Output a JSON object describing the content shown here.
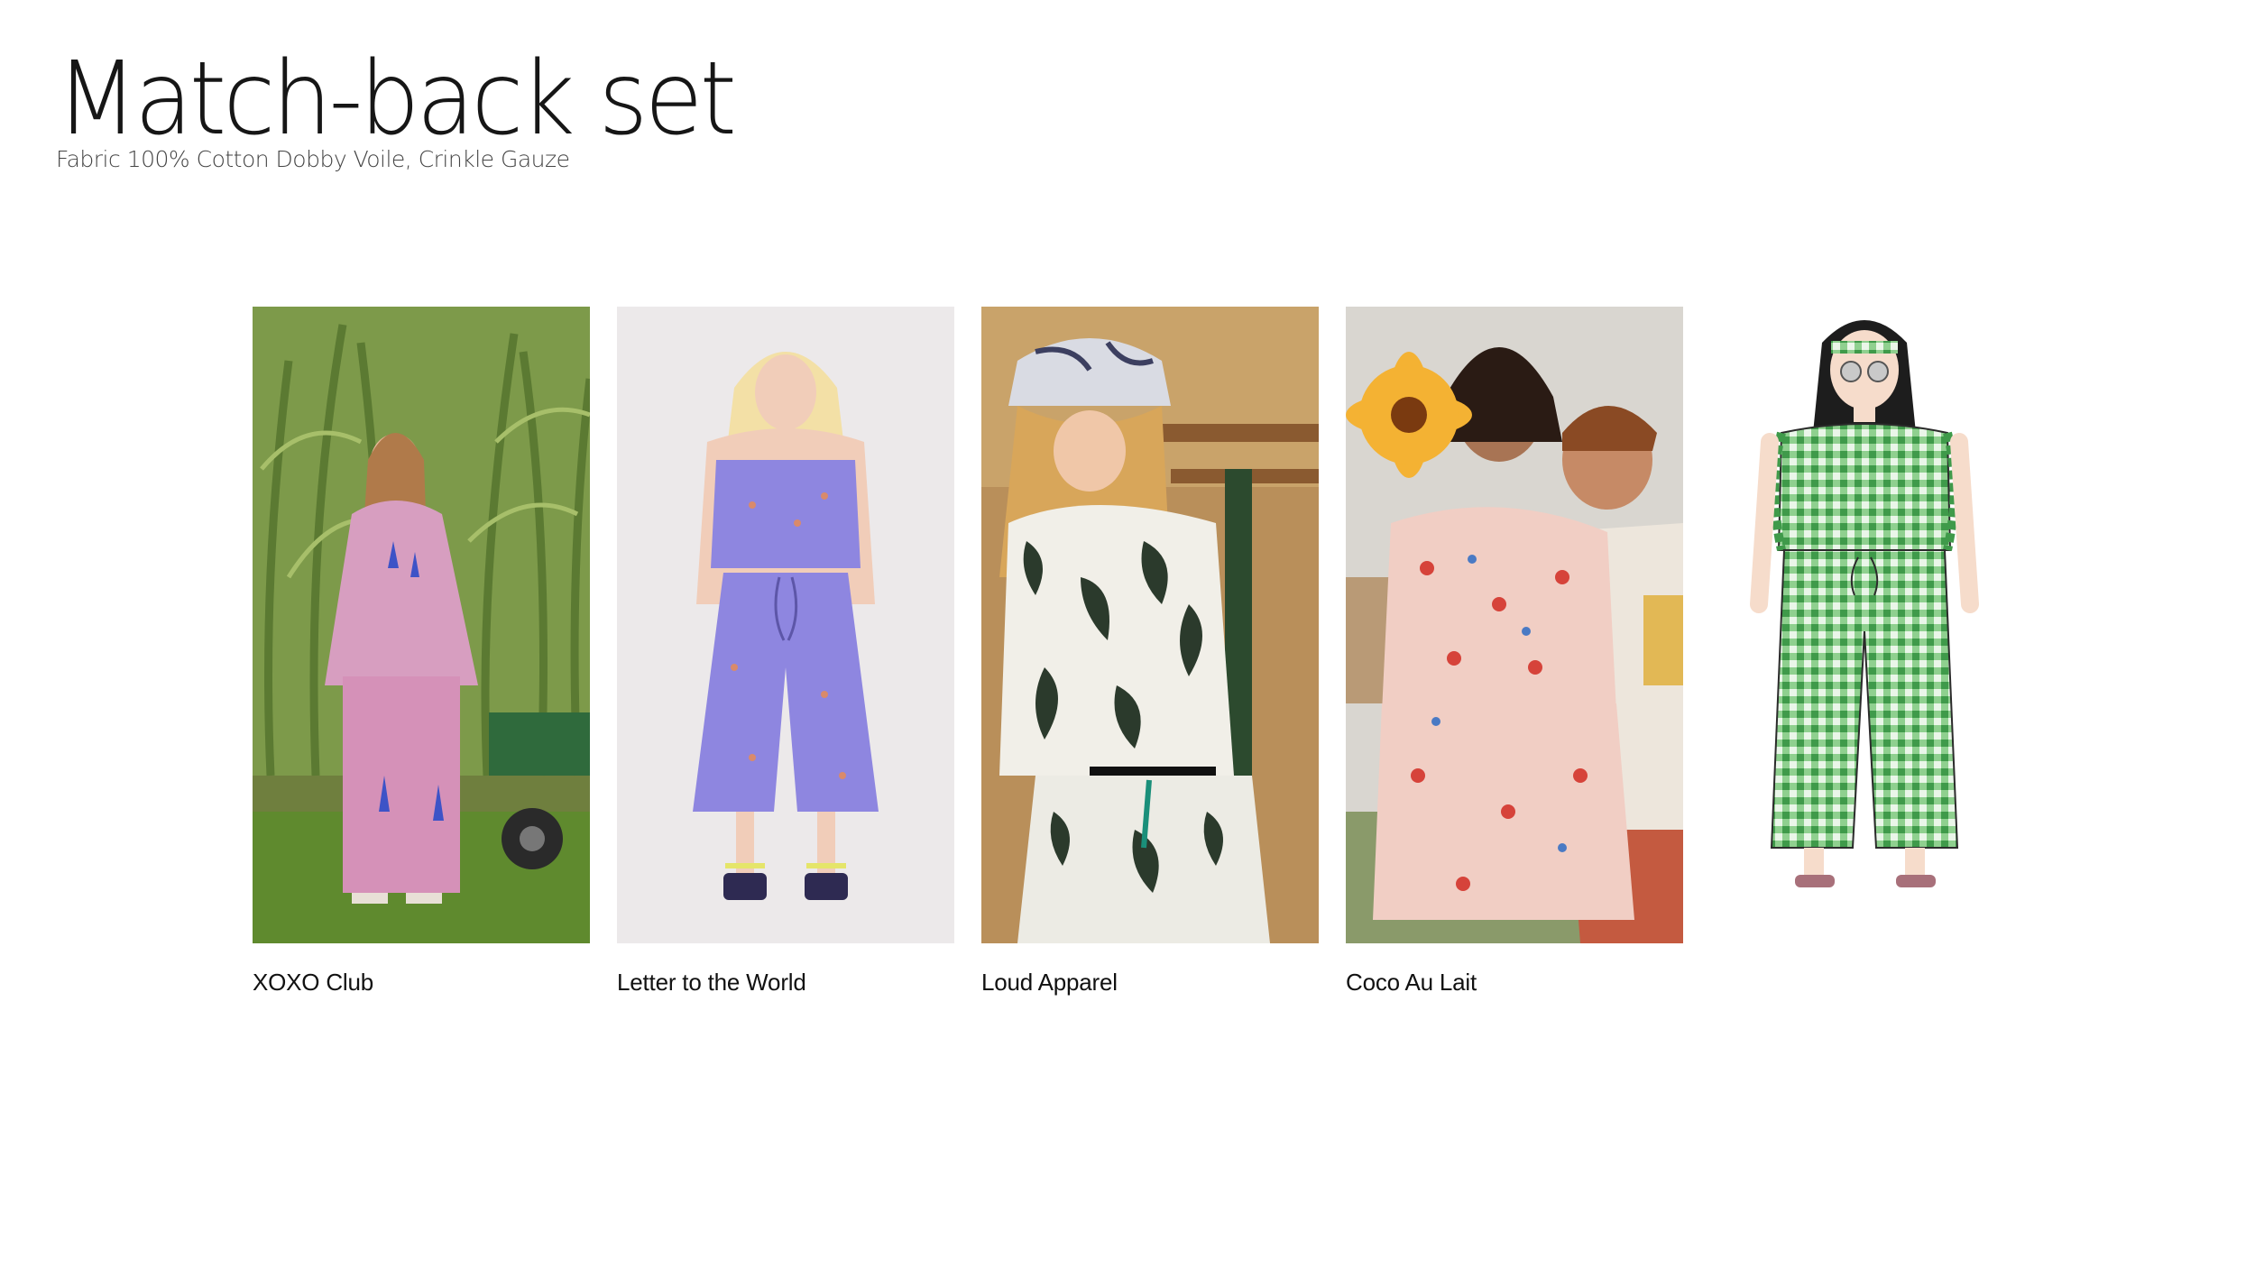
{
  "slide": {
    "title": "Match-back set",
    "subtitle": "Fabric 100% Cotton Dobby Voile, Crinkle Gauze"
  },
  "references": [
    {
      "brand": "XOXO Club",
      "image": "child-lavender-sweatshirt-and-pants-photo"
    },
    {
      "brand": "Letter to the World",
      "image": "child-periwinkle-top-and-wide-pants-photo"
    },
    {
      "brand": "Loud Apparel",
      "image": "child-leaf-print-top-and-shorts-photo"
    },
    {
      "brand": "Coco Au Lait",
      "image": "children-floral-ruffle-set-photo"
    }
  ],
  "sketch": {
    "image": "green-gingham-ruffle-top-and-pants-illustration"
  },
  "colors": {
    "title": "#161616",
    "gingham": "#5fb86a",
    "lavender": "#8e86e0"
  }
}
